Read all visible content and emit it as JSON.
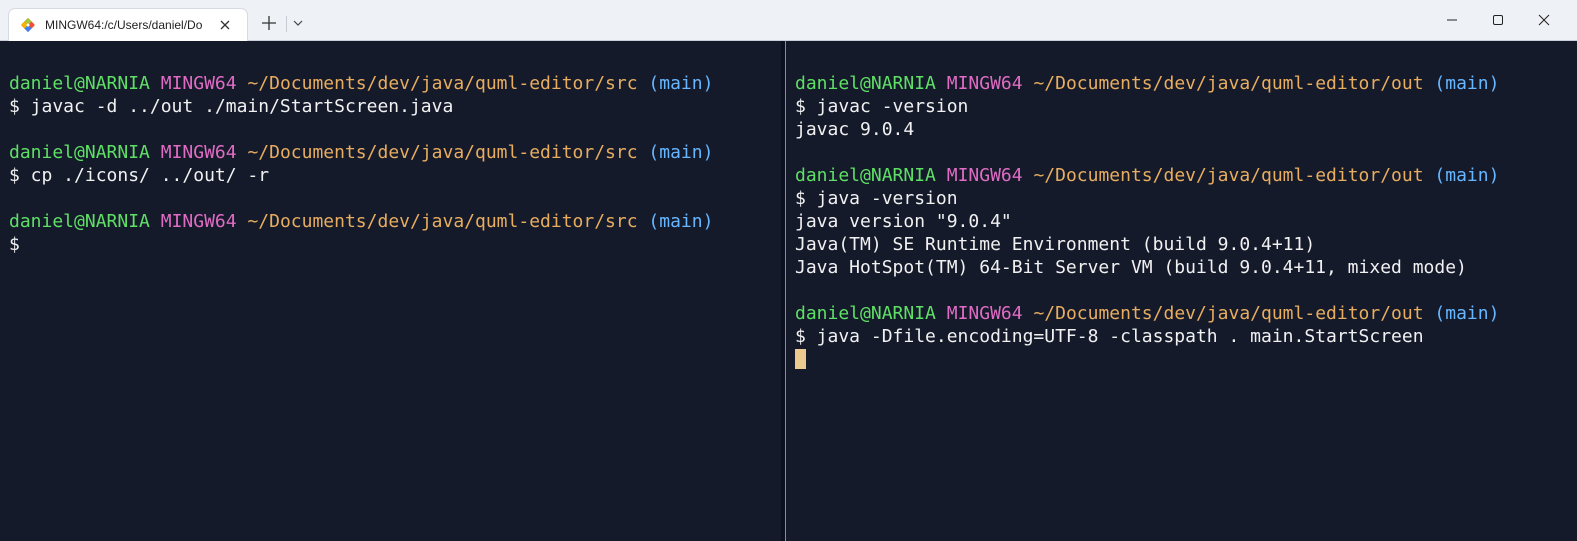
{
  "tab": {
    "title": "MINGW64:/c/Users/daniel/Do",
    "icon": "git-icon"
  },
  "window_controls": {
    "minimize": "minimize-icon",
    "maximize": "maximize-icon",
    "close": "close-icon"
  },
  "colors": {
    "user": "#5ee065",
    "host": "#e06cc4",
    "path": "#e8ad5e",
    "branch": "#66b7ff",
    "text": "#f1f1f1",
    "background": "#151a2b",
    "cursor": "#ecc98f"
  },
  "left_pane": {
    "lines": [
      {
        "type": "prompt",
        "user": "daniel@NARNIA",
        "host": "MINGW64",
        "path": "~/Documents/dev/java/quml-editor/src",
        "branch": "(main)"
      },
      {
        "type": "output",
        "text": "$ javac -d ../out ./main/StartScreen.java"
      },
      {
        "type": "blank",
        "text": ""
      },
      {
        "type": "prompt",
        "user": "daniel@NARNIA",
        "host": "MINGW64",
        "path": "~/Documents/dev/java/quml-editor/src",
        "branch": "(main)"
      },
      {
        "type": "output",
        "text": "$ cp ./icons/ ../out/ -r"
      },
      {
        "type": "blank",
        "text": ""
      },
      {
        "type": "prompt",
        "user": "daniel@NARNIA",
        "host": "MINGW64",
        "path": "~/Documents/dev/java/quml-editor/src",
        "branch": "(main)"
      },
      {
        "type": "output",
        "text": "$"
      }
    ]
  },
  "right_pane": {
    "lines": [
      {
        "type": "prompt",
        "user": "daniel@NARNIA",
        "host": "MINGW64",
        "path": "~/Documents/dev/java/quml-editor/out",
        "branch": "(main)"
      },
      {
        "type": "output",
        "text": "$ javac -version"
      },
      {
        "type": "output",
        "text": "javac 9.0.4"
      },
      {
        "type": "blank",
        "text": ""
      },
      {
        "type": "prompt",
        "user": "daniel@NARNIA",
        "host": "MINGW64",
        "path": "~/Documents/dev/java/quml-editor/out",
        "branch": "(main)"
      },
      {
        "type": "output",
        "text": "$ java -version"
      },
      {
        "type": "output",
        "text": "java version \"9.0.4\""
      },
      {
        "type": "output",
        "text": "Java(TM) SE Runtime Environment (build 9.0.4+11)"
      },
      {
        "type": "output",
        "text": "Java HotSpot(TM) 64-Bit Server VM (build 9.0.4+11, mixed mode)"
      },
      {
        "type": "blank",
        "text": ""
      },
      {
        "type": "prompt",
        "user": "daniel@NARNIA",
        "host": "MINGW64",
        "path": "~/Documents/dev/java/quml-editor/out",
        "branch": "(main)"
      },
      {
        "type": "output",
        "text": "$ java -Dfile.encoding=UTF-8 -classpath . main.StartScreen"
      },
      {
        "type": "cursor",
        "text": ""
      }
    ]
  }
}
